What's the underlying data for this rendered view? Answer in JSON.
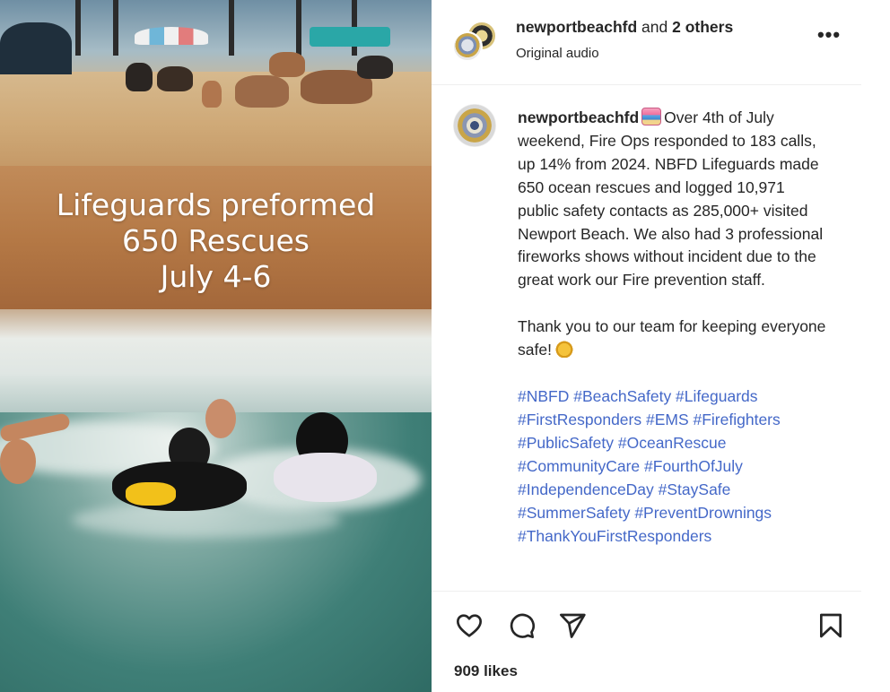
{
  "media": {
    "overlay_lines": [
      "Lifeguards preformed",
      "650 Rescues",
      "July 4-6"
    ]
  },
  "header": {
    "author": "newportbeachfd",
    "connector": " and ",
    "others": "2 others",
    "audio": "Original audio",
    "more": "•••"
  },
  "caption": {
    "username": "newportbeachfd",
    "text_1": "Over 4th of July weekend, Fire Ops responded to 183 calls, up 14% from 2024. NBFD Lifeguards made 650 ocean rescues and logged 10,971 public safety contacts as 285,000+ visited Newport Beach. We also had 3 professional fireworks shows without incident due to the great work our Fire prevention staff.",
    "text_2": "Thank you to our team for keeping everyone safe!",
    "hashtag_lines": [
      "#NBFD #BeachSafety #Lifeguards",
      "#FirstResponders #EMS #Firefighters",
      "#PublicSafety #OceanRescue",
      "#CommunityCare #FourthOfJuly",
      "#IndependenceDay #StaySafe",
      "#SummerSafety #PreventDrownings",
      "#ThankYouFirstResponders"
    ]
  },
  "icons": {
    "like": "heart-icon",
    "comment": "comment-icon",
    "share": "share-icon",
    "save": "bookmark-icon"
  },
  "likes": "909 likes"
}
